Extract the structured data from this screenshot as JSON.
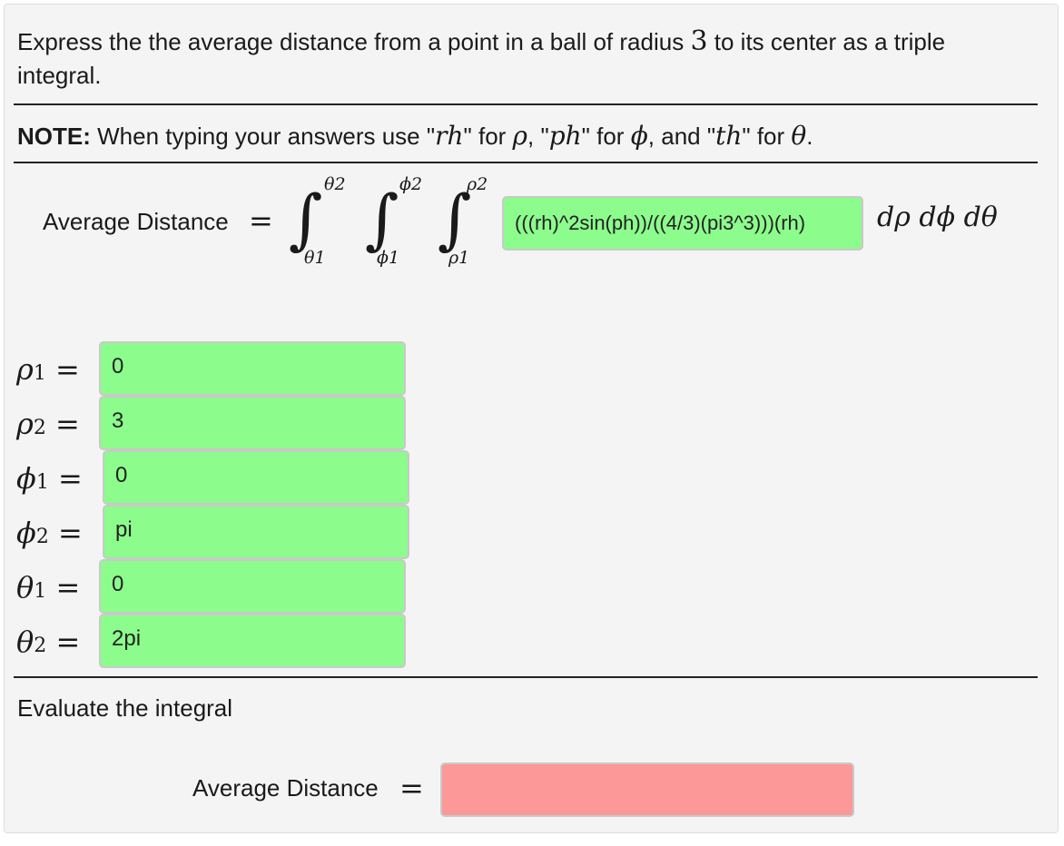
{
  "question": {
    "line1_pre": "Express the the average distance from a point in a ball of radius",
    "radius": "3",
    "line1_post": "to its center as a triple",
    "line2": "integral."
  },
  "note": {
    "label": "NOTE:",
    "text1": "When typing your answers use \"",
    "rh": "rh",
    "text2": "\" for",
    "rho": "ρ",
    "text3": ", \"",
    "ph": "ph",
    "text4": "\" for",
    "phi": "ϕ",
    "text5": ", and \"",
    "th": "th",
    "text6": "\" for",
    "theta": "θ",
    "text7": "."
  },
  "integral": {
    "label": "Average Distance",
    "equals": "=",
    "upper_theta": "θ2",
    "lower_theta": "θ1",
    "upper_phi": "ϕ2",
    "lower_phi": "ϕ1",
    "upper_rho": "ρ2",
    "lower_rho": "ρ1",
    "integrand": "(((rh)^2sin(ph))/((4/3)(pi3^3)))(rh)",
    "differentials": "dρ dϕ dθ"
  },
  "bounds": [
    {
      "var": "ρ",
      "sub": "1",
      "value": "0"
    },
    {
      "var": "ρ",
      "sub": "2",
      "value": "3"
    },
    {
      "var": "ϕ",
      "sub": "1",
      "value": "0"
    },
    {
      "var": "ϕ",
      "sub": "2",
      "value": "pi"
    },
    {
      "var": "θ",
      "sub": "1",
      "value": "0"
    },
    {
      "var": "θ",
      "sub": "2",
      "value": "2pi"
    }
  ],
  "evaluate": {
    "heading": "Evaluate the integral",
    "label": "Average Distance",
    "equals": "=",
    "value": ""
  },
  "colors": {
    "correct": "#8cfc8c",
    "incorrect": "#fc9898"
  }
}
